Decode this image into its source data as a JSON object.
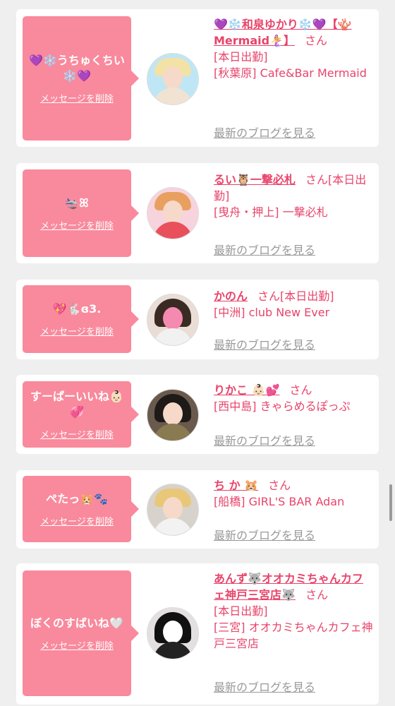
{
  "delete_label": "メッセージを削除",
  "san_label": "さん",
  "blog_label": "最新のブログを見る",
  "accent_color": "#f9899c",
  "text_color": "#e8446a",
  "items": [
    {
      "message": "💜❄️うちゅくちい❄️💜",
      "name": "💜❄️和泉ゆかり❄️💜【🪸Mermaid🧜‍♀️】",
      "status": "[本日出勤]",
      "shop": "[秋葉原] Cafe&Bar Mermaid"
    },
    {
      "message": "🛬ꕤ",
      "name": "るい🦉一撃必札",
      "status": "[本日出勤]",
      "shop": "[曳舟・押上] 一撃必札"
    },
    {
      "message": "💖🐇ɞ3.",
      "name": "かのん",
      "status": "[本日出勤]",
      "shop": "[中洲] club New Ever"
    },
    {
      "message": "すーぱーいいね👶🏻💞",
      "name": "りかこ 👶🏻💕",
      "status": "",
      "shop": "[西中島] きゃらめるぽっぷ"
    },
    {
      "message": "ぺたっ🐹🐾",
      "name": "ち か 🐹",
      "status": "",
      "shop": "[船橋] GIRL'S BAR Adan"
    },
    {
      "message": "ぼくのすばいね🤍",
      "name": "あんず🐺オオカミちゃんカフェ神戸三宮店🐺",
      "status": "[本日出勤]",
      "shop": "[三宮] オオカミちゃんカフェ神戸三宮店"
    }
  ]
}
